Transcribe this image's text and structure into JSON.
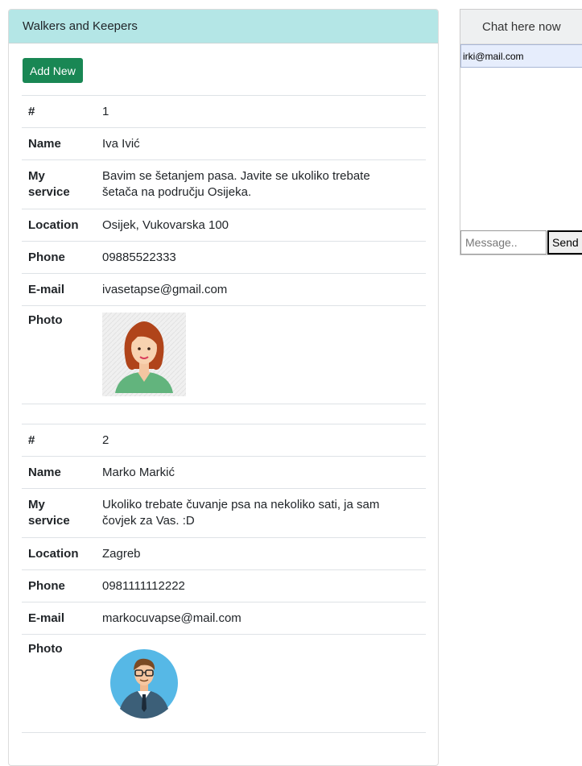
{
  "panel": {
    "title": "Walkers and Keepers",
    "add_button": "Add New"
  },
  "labels": {
    "id": "#",
    "name": "Name",
    "service_line1": "My",
    "service_line2": "service",
    "location": "Location",
    "phone": "Phone",
    "email": "E-mail",
    "photo": "Photo"
  },
  "walkers": [
    {
      "id": "1",
      "name": "Iva Ivić",
      "service_line1": "Bavim se šetanjem pasa. Javite se ukoliko trebate",
      "service_line2": "šetača na području Osijeka.",
      "location": "Osijek, Vukovarska 100",
      "phone": "09885522333",
      "email": "ivasetapse@gmail.com",
      "photo_icon": "woman-avatar-icon"
    },
    {
      "id": "2",
      "name": "Marko Markić",
      "service_line1": "Ukoliko trebate čuvanje psa na nekoliko sati, ja sam",
      "service_line2": "čovjek za Vas. :D",
      "location": "Zagreb",
      "phone": "0981111112222",
      "email": "markocuvapse@mail.com",
      "photo_icon": "man-avatar-icon"
    }
  ],
  "chat": {
    "title": "Chat here now",
    "user": "irki@mail.com",
    "input_placeholder": "Message..",
    "send_label": "Send"
  },
  "colors": {
    "header_bg": "#b4e6e6",
    "add_button": "#198754"
  }
}
